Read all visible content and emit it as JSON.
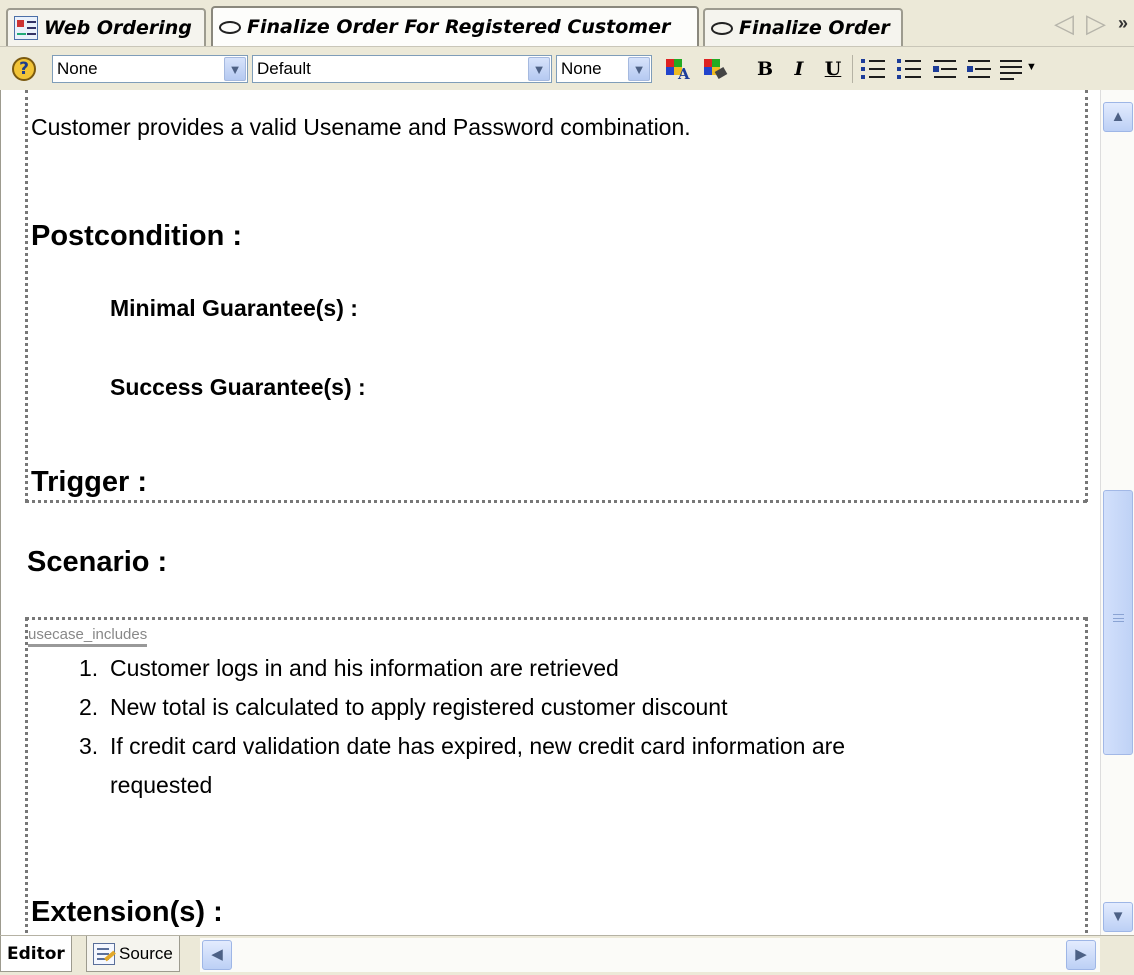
{
  "tabs": [
    {
      "label": "Web Ordering",
      "icon": "diagram-icon",
      "active": false
    },
    {
      "label": "Finalize Order For Registered Customer",
      "icon": "usecase-icon",
      "active": true
    },
    {
      "label": "Finalize Order",
      "icon": "usecase-icon",
      "active": false
    }
  ],
  "toolbar": {
    "style_select": "None",
    "font_select": "Default",
    "size_select": "None",
    "bold": "B",
    "italic": "I",
    "underline": "U"
  },
  "document": {
    "precondition_text": "Customer provides a valid Usename and Password combination.",
    "postcondition_heading": "Postcondition :",
    "minimal_guarantee": "Minimal Guarantee(s) :",
    "success_guarantee": "Success Guarantee(s) :",
    "trigger_heading": "Trigger :",
    "scenario_heading": "Scenario :",
    "includes_tag": "usecase_includes",
    "steps": [
      {
        "num": "1.",
        "text": "Customer logs in and his information are retrieved"
      },
      {
        "num": "2.",
        "text": "New total is calculated to apply registered customer discount"
      },
      {
        "num": "3.",
        "text": "If credit card validation date  has expired, new credit card information are"
      }
    ],
    "step3_continuation": "requested",
    "extensions_heading": "Extension(s) :"
  },
  "bottom_tabs": {
    "editor": "Editor",
    "source": "Source"
  }
}
